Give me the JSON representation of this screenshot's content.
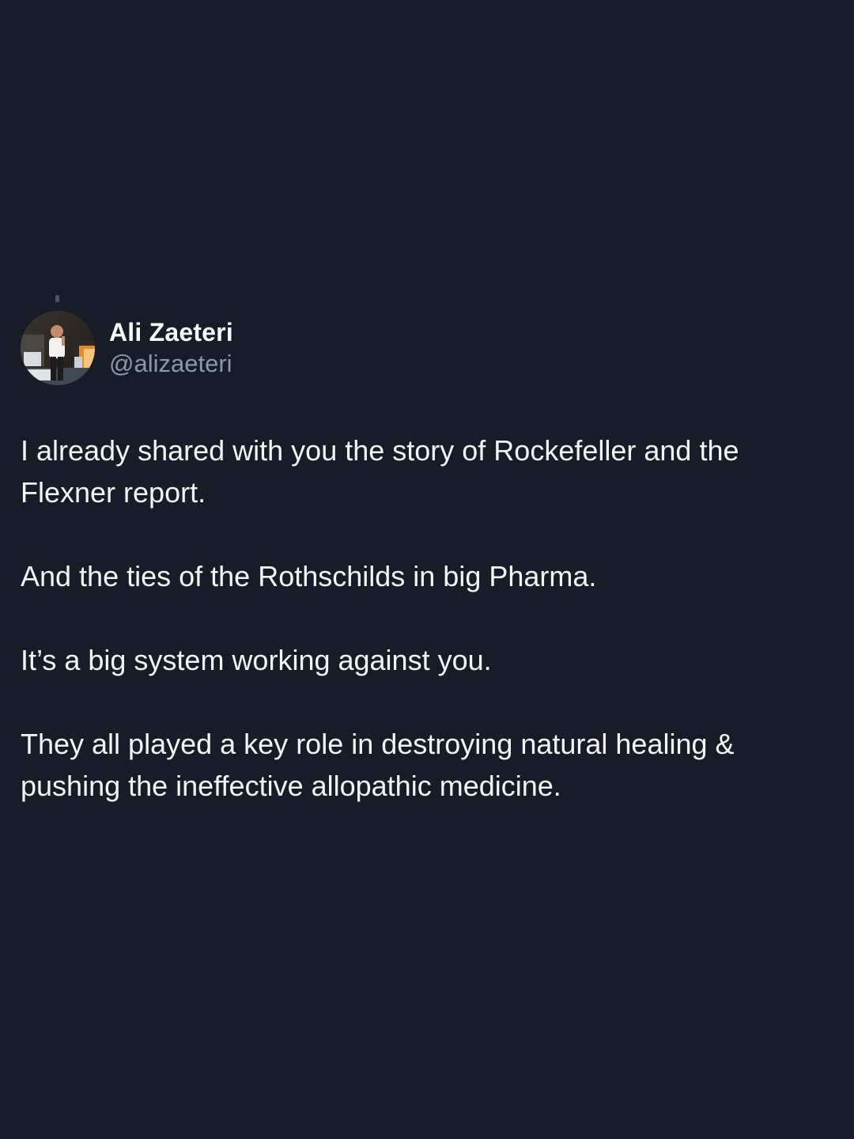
{
  "tweet": {
    "author": {
      "display_name": "Ali Zaeteri",
      "handle": "@alizaeteri",
      "avatar_icon": "profile-photo"
    },
    "paragraphs": [
      "I already shared with you the story of Rockefeller and the Flexner report.",
      "And the ties of the Rothschilds in big Pharma.",
      "It’s a big system working against you.",
      "They all played a key role in destroying natural healing & pushing the ineffective allopathic medicine."
    ]
  },
  "colors": {
    "background": "#171d28",
    "text": "#f2f4f6",
    "handle": "#8b98a5"
  }
}
